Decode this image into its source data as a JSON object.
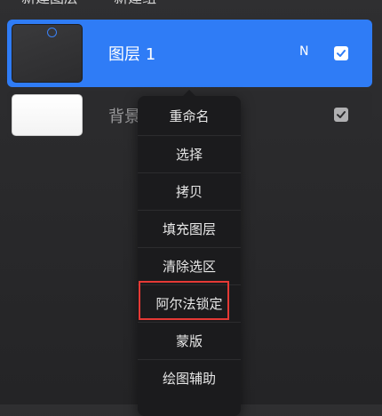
{
  "header": {
    "new_layer_label": "新建图层",
    "new_group_label": "新建组"
  },
  "layers": [
    {
      "name": "图层 1",
      "blend_mode": "N",
      "visible": true,
      "selected": true
    },
    {
      "name": "背景",
      "visible": true,
      "selected": false
    }
  ],
  "context_menu": {
    "items": [
      "重命名",
      "选择",
      "拷贝",
      "填充图层",
      "清除选区",
      "阿尔法锁定",
      "蒙版",
      "绘图辅助"
    ],
    "highlighted_item": "阿尔法锁定"
  },
  "colors": {
    "accent": "#2f7cf6",
    "highlight": "#e53935",
    "menu_bg": "#1b1b1d"
  },
  "icons": {
    "checkbox": "checkbox-checked-icon"
  }
}
